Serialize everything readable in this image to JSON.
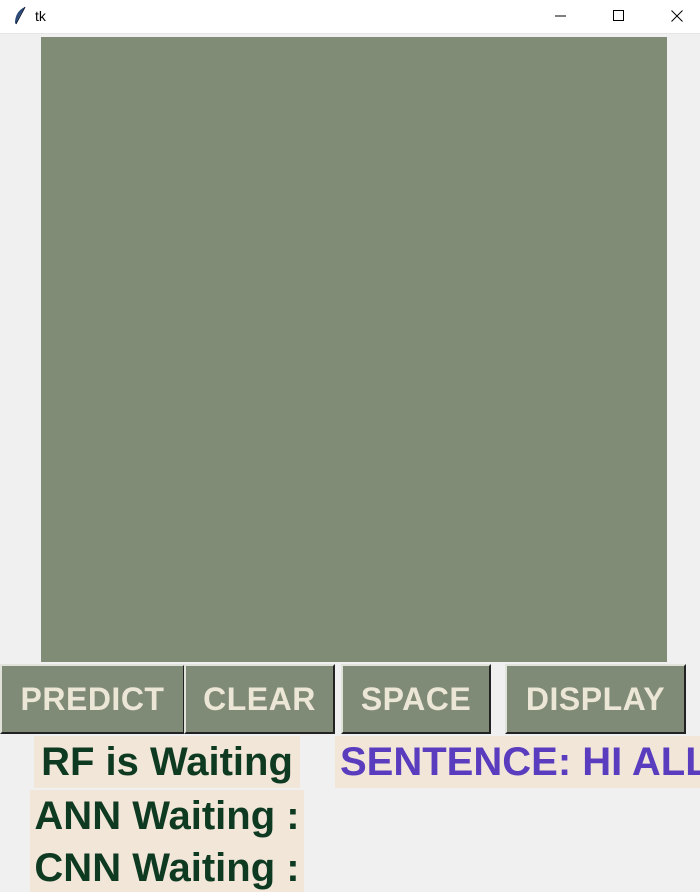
{
  "window": {
    "title": "tk",
    "icons": {
      "app": "feather-icon",
      "minimize": "minimize-icon",
      "maximize": "maximize-icon",
      "close": "close-icon"
    }
  },
  "canvas": {
    "color": "#818c77"
  },
  "buttons": {
    "predict": "PREDICT",
    "clear": "CLEAR",
    "space": "SPACE",
    "display": "DISPLAY",
    "bg_color": "#808b77",
    "text_color": "#ece6d7"
  },
  "status": {
    "rf": "RF is Waiting",
    "ann": "ANN Waiting :",
    "cnn": "CNN Waiting :",
    "text_color": "#0f3a22",
    "bg_color": "#f1e6d8"
  },
  "sentence": {
    "text": "SENTENCE: HI ALL",
    "color": "#5a3cbf"
  }
}
